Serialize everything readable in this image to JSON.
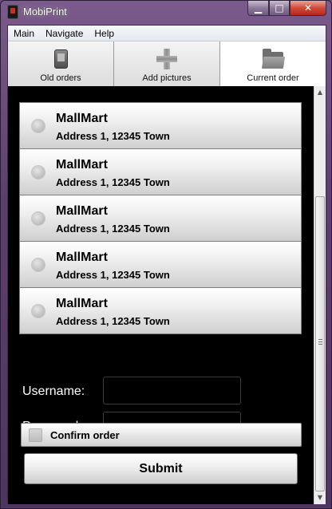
{
  "window": {
    "title": "MobiPrint",
    "controls": {
      "minimize": "▁",
      "maximize": "□",
      "close": "✕"
    }
  },
  "menu": {
    "items": [
      {
        "label": "Main"
      },
      {
        "label": "Navigate"
      },
      {
        "label": "Help"
      }
    ]
  },
  "tabs": [
    {
      "label": "Old orders",
      "icon": "phone-icon"
    },
    {
      "label": "Add pictures",
      "icon": "plus-icon"
    },
    {
      "label": "Current order",
      "icon": "folder-icon",
      "active": true
    }
  ],
  "stores": [
    {
      "name": "MallMart",
      "address": "Address 1, 12345 Town"
    },
    {
      "name": "MallMart",
      "address": "Address 1, 12345 Town"
    },
    {
      "name": "MallMart",
      "address": "Address 1, 12345 Town"
    },
    {
      "name": "MallMart",
      "address": "Address 1, 12345 Town"
    },
    {
      "name": "MallMart",
      "address": "Address 1, 12345 Town"
    }
  ],
  "form": {
    "username_label": "Username:",
    "username_value": "",
    "password_label": "Password:",
    "password_value": "",
    "confirm_label": "Confirm order",
    "confirm_checked": false,
    "submit_label": "Submit"
  },
  "scrollbar": {
    "up_arrow": "▲",
    "down_arrow": "▼"
  }
}
